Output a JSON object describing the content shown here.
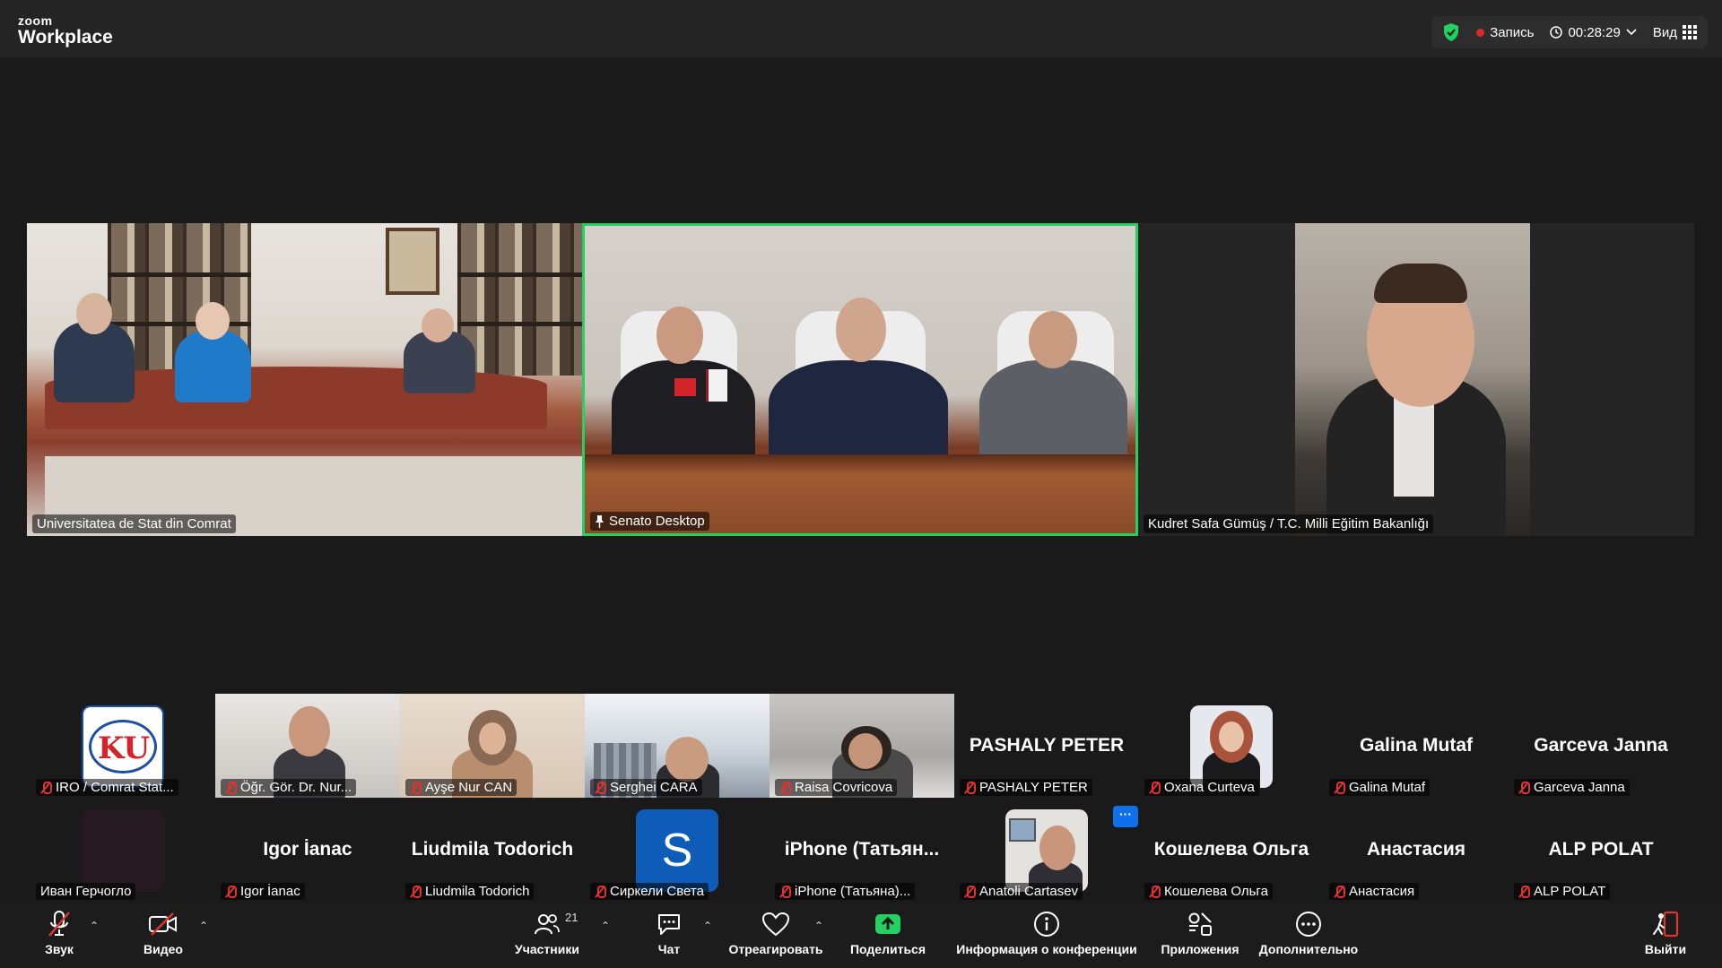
{
  "app": {
    "brand_small": "zoom",
    "brand_large": "Workplace"
  },
  "header": {
    "recording": "Запись",
    "timer": "00:28:29",
    "view": "Вид"
  },
  "main_tiles": [
    {
      "name": "Universitatea de Stat din Comrat"
    },
    {
      "name": "Senato Desktop",
      "pinned": true
    },
    {
      "name": "Kudret Safa Gümüş / T.C. Milli Eğitim Bakanlığı"
    }
  ],
  "thumbnails_row1": [
    {
      "label": "IRO / Comrat Stat...",
      "big": ""
    },
    {
      "label": "Öğr. Gör. Dr. Nur...",
      "big": ""
    },
    {
      "label": "Ayşe Nur CAN",
      "big": ""
    },
    {
      "label": "Serghei CARA",
      "big": ""
    },
    {
      "label": "Raisa Covricova",
      "big": ""
    },
    {
      "label": "PASHALY PETER",
      "big": "PASHALY PETER"
    },
    {
      "label": "Oxana Curteva",
      "big": ""
    },
    {
      "label": "Galina Mutaf",
      "big": "Galina Mutaf"
    },
    {
      "label": "Garceva Janna",
      "big": "Garceva Janna"
    }
  ],
  "thumbnails_row2": [
    {
      "label": "Иван Герчогло",
      "big": ""
    },
    {
      "label": "Igor İanac",
      "big": "Igor İanac"
    },
    {
      "label": "Liudmila Todorich",
      "big": "Liudmila Todorich"
    },
    {
      "label": "Сиркели Света",
      "big": "",
      "avatar_letter": "S"
    },
    {
      "label": "iPhone (Татьяна)...",
      "big": "iPhone (Татьян..."
    },
    {
      "label": "Anatoli Cartasev",
      "big": ""
    },
    {
      "label": "Кошелева Ольга",
      "big": "Кошелева Ольга"
    },
    {
      "label": "Анастасия",
      "big": "Анастасия"
    },
    {
      "label": "ALP POLAT",
      "big": "ALP POLAT"
    }
  ],
  "overflow_dots": "···",
  "toolbar": {
    "audio": "Звук",
    "video": "Видео",
    "participants": "Участники",
    "participants_count": "21",
    "chat": "Чат",
    "react": "Отреагировать",
    "share": "Поделиться",
    "info": "Информация о конференции",
    "apps": "Приложения",
    "more": "Дополнительно",
    "leave": "Выйти"
  },
  "colors": {
    "active_border": "#23d160",
    "record": "#e02828",
    "share_green": "#23d160",
    "accent_blue": "#0e71eb",
    "leave_red": "#e0332f"
  }
}
